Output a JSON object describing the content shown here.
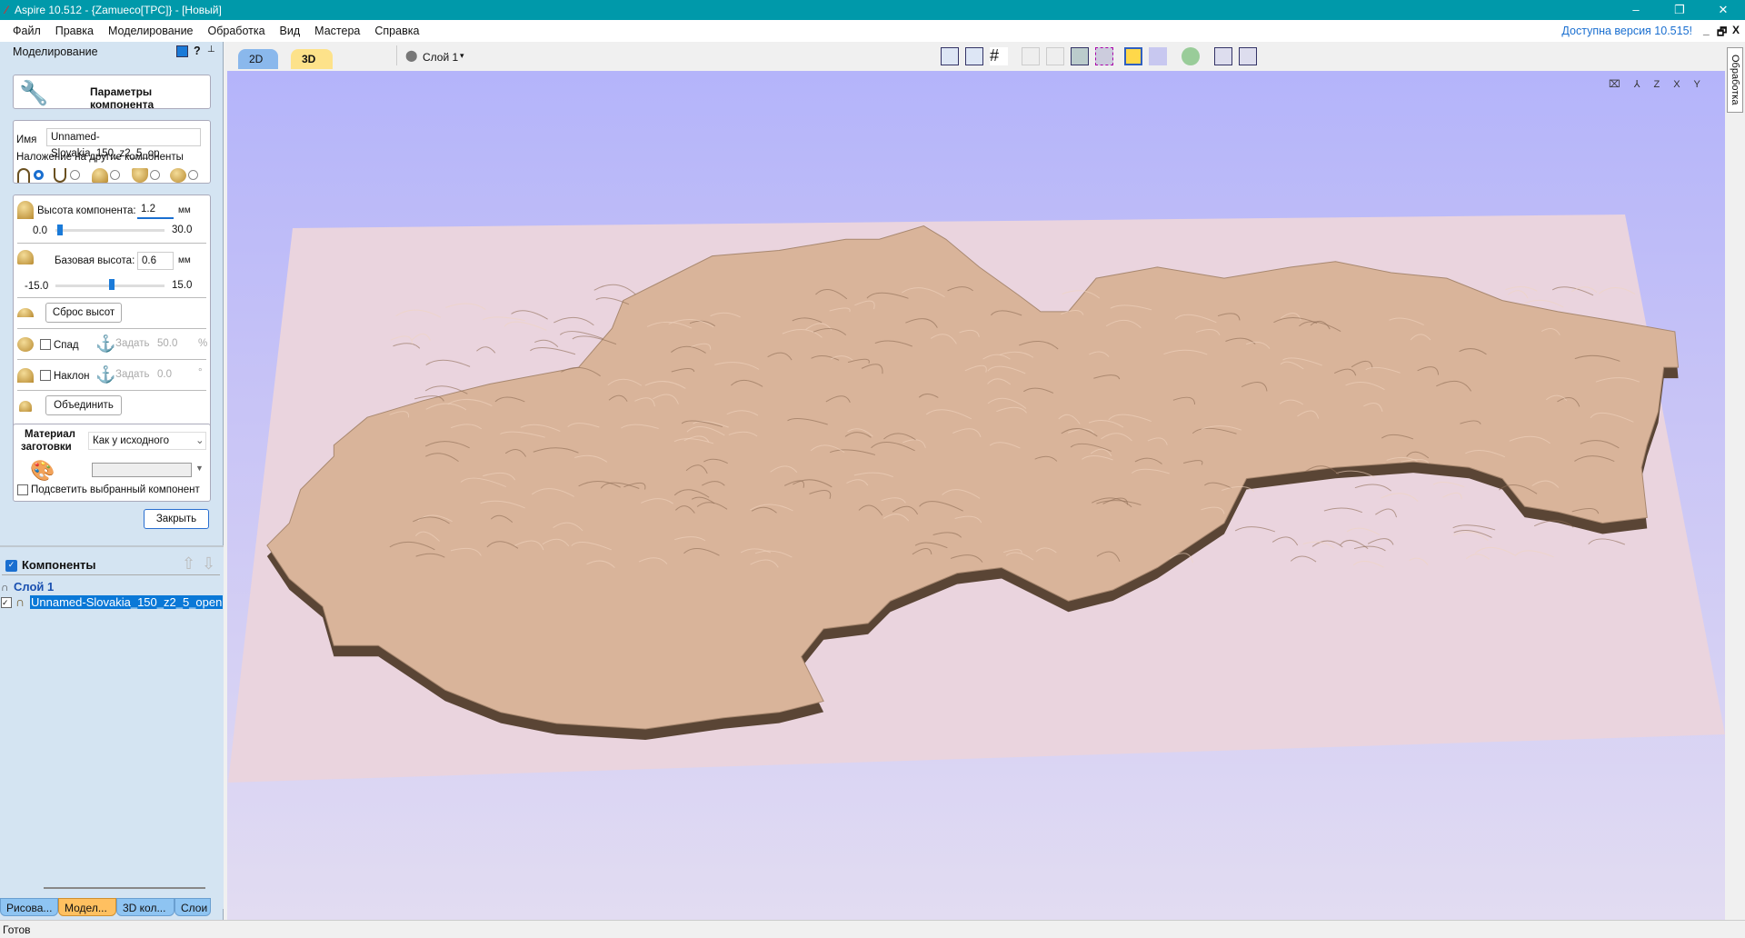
{
  "window": {
    "title": "Aspire 10.512 - {Zamueco[TPC]} - [Новый]",
    "minimize": "–",
    "maximize": "❐",
    "close": "✕"
  },
  "menu": [
    "Файл",
    "Правка",
    "Моделирование",
    "Обработка",
    "Вид",
    "Мастера",
    "Справка"
  ],
  "update_notice": "Доступна версия 10.515!",
  "mdi": {
    "min": "_",
    "restore": "🗗",
    "close": "X"
  },
  "panel": {
    "title": "Моделирование",
    "help": "?",
    "pin": "📌",
    "header_button": "Параметры компонента",
    "name_label": "Имя",
    "name_value": "Unnamed-Slovakia_150_z2_5_op",
    "overlay_label": "Наложение на другие компоненты",
    "overlay_selected": 0,
    "height_label": "Высота компонента:",
    "height_value": "1.2",
    "height_unit": "мм",
    "height_min": "0.0",
    "height_max": "30.0",
    "height_slider": 1.2,
    "base_label": "Базовая высота:",
    "base_value": "0.6",
    "base_unit": "мм",
    "base_min": "-15.0",
    "base_max": "15.0",
    "base_slider": 0.6,
    "reset_button": "Сброс высот",
    "fade_label": "Спад",
    "fade_set": "Задать",
    "fade_value": "50.0",
    "fade_unit": "%",
    "tilt_label": "Наклон",
    "tilt_set": "Задать",
    "tilt_value": "0.0",
    "tilt_unit": "°",
    "merge_button": "Объединить",
    "material_label_1": "Материал",
    "material_label_2": "заготовки",
    "material_value": "Как у исходного",
    "highlight_label": "Подсветить выбранный компонент",
    "close_button": "Закрыть"
  },
  "components": {
    "title": "Компоненты",
    "layer": "Слой 1",
    "item": "Unnamed-Slovakia_150_z2_5_open"
  },
  "bottom_tabs": [
    "Рисова...",
    "Модел...",
    "3D кол...",
    "Слои"
  ],
  "active_bottom_tab": 1,
  "view_tabs": [
    "2D вид",
    "3D вид"
  ],
  "layer_dropdown": "Слой 1",
  "right_tab": "Обработка",
  "status": "Готов",
  "colors": {
    "titlebar": "#0099aa",
    "terrain": "#d9b49a",
    "plane": "#e8d0dc",
    "viewport_top": "#b4b4fa"
  }
}
